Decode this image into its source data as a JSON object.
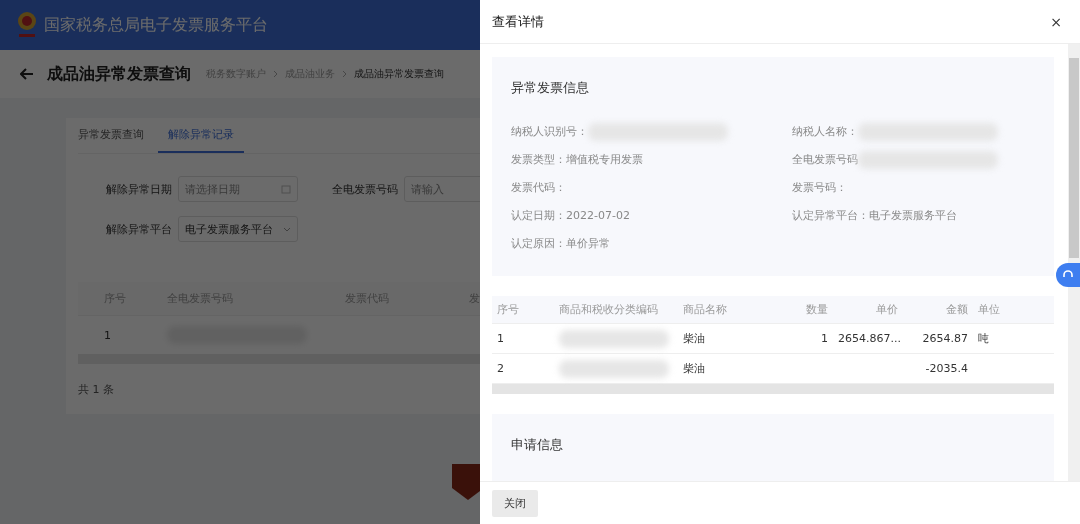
{
  "header": {
    "title": "国家税务总局电子发票服务平台"
  },
  "page": {
    "title": "成品油异常发票查询",
    "breadcrumb": [
      "税务数字账户",
      "成品油业务",
      "成品油异常发票查询"
    ]
  },
  "tabs": [
    {
      "label": "异常发票查询",
      "selected": false
    },
    {
      "label": "解除异常记录",
      "selected": true
    }
  ],
  "filters": [
    {
      "label": "解除异常日期",
      "kind": "date",
      "placeholder": "请选择日期"
    },
    {
      "label": "全电发票号码",
      "kind": "text",
      "placeholder": "请输入"
    },
    {
      "label": "解除异常平台",
      "kind": "select",
      "value": "电子发票服务平台"
    }
  ],
  "table": {
    "columns": [
      "序号",
      "全电发票号码",
      "发票代码",
      "发"
    ],
    "rows": [
      [
        {
          "text": "1",
          "redacted": false
        },
        {
          "redacted": true
        }
      ]
    ]
  },
  "total": "共 1 条",
  "drawer": {
    "title": "查看详情",
    "close": "×",
    "info": {
      "title": "异常发票信息",
      "fields": [
        {
          "label": "纳税人识别号：",
          "redacted": true
        },
        {
          "label": "纳税人名称：",
          "redacted": true
        },
        {
          "label": "发票类型：",
          "value": "增值税专用发票",
          "redacted": false
        },
        {
          "label": "全电发票号码",
          "redacted": true
        },
        {
          "label": "发票代码：",
          "redacted": false
        },
        {
          "label": "发票号码：",
          "redacted": false
        },
        {
          "label": "认定日期：",
          "value": "2022-07-02",
          "redacted": false
        },
        {
          "label": "认定异常平台：",
          "value": "电子发票服务平台",
          "redacted": false
        },
        {
          "label": "认定原因：",
          "value": "单价异常",
          "redacted": false
        }
      ]
    },
    "items": {
      "columns": [
        "序号",
        "商品和税收分类编码",
        "商品名称",
        "数量",
        "单价",
        "金额",
        "单位"
      ],
      "rows": [
        [
          {
            "text": "1",
            "redacted": false
          },
          {
            "redacted": true
          },
          {
            "text": "柴油",
            "redacted": false
          },
          {
            "text": "1",
            "redacted": false
          },
          {
            "text": "2654.867...",
            "redacted": false
          },
          {
            "text": "2654.87",
            "redacted": false
          },
          {
            "text": "吨",
            "redacted": false
          }
        ],
        [
          {
            "text": "2",
            "redacted": false
          },
          {
            "redacted": true
          },
          {
            "text": "柴油",
            "redacted": false
          },
          {
            "redacted": false
          },
          {
            "redacted": false
          },
          {
            "text": "-2035.4",
            "redacted": false
          },
          {
            "redacted": false
          }
        ]
      ]
    },
    "apply": {
      "title": "申请信息"
    },
    "buttons": [
      "关闭"
    ]
  }
}
